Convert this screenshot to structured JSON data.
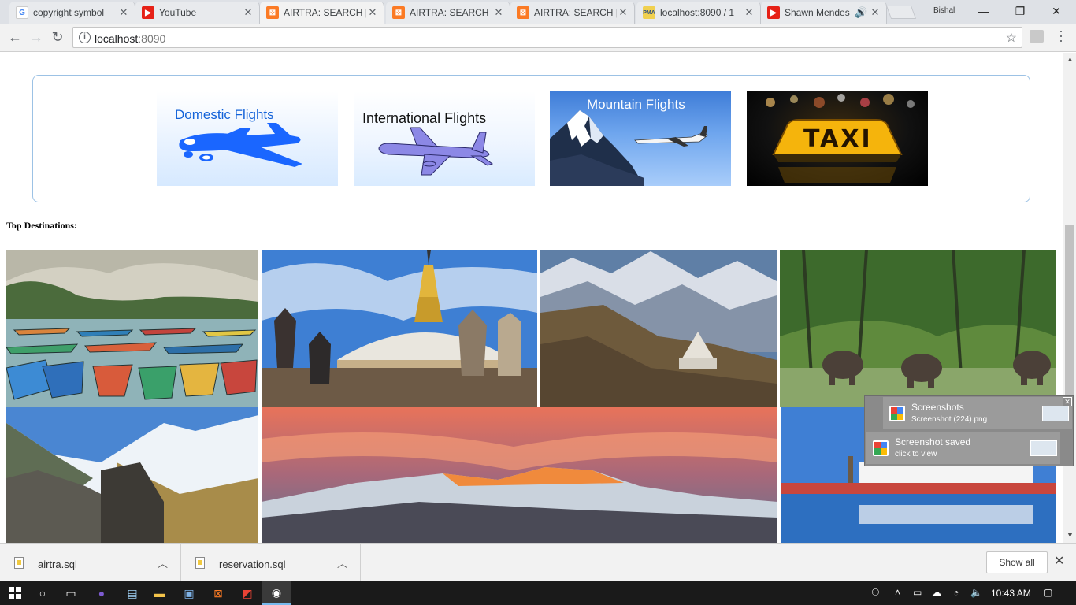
{
  "browser": {
    "tabs": [
      {
        "title": "copyright symbol",
        "icon": "google-icon",
        "active": false
      },
      {
        "title": "YouTube",
        "icon": "youtube-icon",
        "active": false
      },
      {
        "title": "AIRTRA: SEARCH |",
        "icon": "xampp-icon",
        "active": true
      },
      {
        "title": "AIRTRA: SEARCH |",
        "icon": "xampp-icon",
        "active": false
      },
      {
        "title": "AIRTRA: SEARCH |",
        "icon": "xampp-icon",
        "active": false
      },
      {
        "title": "localhost:8090 / 1",
        "icon": "phpmyadmin-icon",
        "active": false
      },
      {
        "title": "Shawn Mendes",
        "icon": "youtube-icon",
        "active": false,
        "audio": true
      }
    ],
    "profile_name": "Bishal",
    "url_host": "localhost",
    "url_port": ":8090"
  },
  "services": {
    "domestic_label": "Domestic Flights",
    "international_label": "International Flights",
    "mountain_label": "Mountain Flights",
    "taxi_label": "TAXI"
  },
  "destinations": {
    "heading": "Top Destinations:",
    "items": [
      {
        "id": "lake-boats"
      },
      {
        "id": "stupa-temple"
      },
      {
        "id": "everest-stupa"
      },
      {
        "id": "elephant-safari"
      },
      {
        "id": "himalaya-ruins"
      },
      {
        "id": "sunset-peaks"
      },
      {
        "id": "palace-reflection"
      }
    ]
  },
  "notifications": [
    {
      "title": "Screenshots",
      "subtitle": "Screenshot (224).png"
    },
    {
      "title": "Screenshot saved",
      "subtitle": "click to view"
    }
  ],
  "downloads": {
    "files": [
      "airtra.sql",
      "reservation.sql"
    ],
    "show_all_label": "Show all"
  },
  "taskbar": {
    "time": "10:43 AM"
  },
  "colors": {
    "accent_blue": "#1463d9",
    "service_border": "#9cc2e5"
  }
}
